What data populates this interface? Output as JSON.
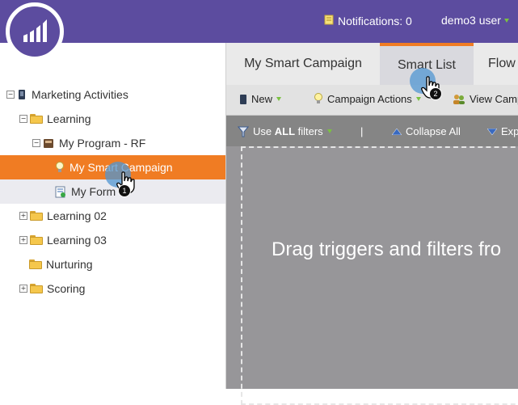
{
  "header": {
    "notifications_label": "Notifications: 0",
    "user_label": "demo3 user",
    "logo_icon": "marketo-logo",
    "colors": {
      "bar": "#5c4c9f",
      "accent": "#f07c23"
    }
  },
  "tree": {
    "items": [
      {
        "label": "Marketing Activities",
        "icon": "marketing-activities-icon",
        "expander": "−"
      },
      {
        "label": "Learning",
        "icon": "folder-icon",
        "expander": "−"
      },
      {
        "label": "My Program - RF",
        "icon": "program-icon",
        "expander": "−"
      },
      {
        "label": "My Smart Campaign",
        "icon": "lightbulb-icon",
        "expander": ""
      },
      {
        "label": "My Form",
        "icon": "form-icon",
        "expander": ""
      },
      {
        "label": "Learning 02",
        "icon": "folder-icon",
        "expander": "+"
      },
      {
        "label": "Learning 03",
        "icon": "folder-icon",
        "expander": "+"
      },
      {
        "label": "Nurturing",
        "icon": "folder-icon",
        "expander": ""
      },
      {
        "label": "Scoring",
        "icon": "folder-icon",
        "expander": "+"
      }
    ]
  },
  "tabs": [
    {
      "label": "My Smart Campaign"
    },
    {
      "label": "Smart List"
    },
    {
      "label": "Flow"
    }
  ],
  "toolbar": {
    "new_label": "New",
    "campaign_actions_label": "Campaign Actions",
    "view_label": "View Camp"
  },
  "filterbar": {
    "use_prefix": "Use ",
    "use_bold": "ALL",
    "use_suffix": " filters",
    "separator": "|",
    "collapse_label": "Collapse All",
    "expand_label": "Exp"
  },
  "canvas": {
    "drag_text": "Drag triggers and filters fro"
  },
  "tips": [
    {
      "number": "1"
    },
    {
      "number": "2"
    }
  ]
}
